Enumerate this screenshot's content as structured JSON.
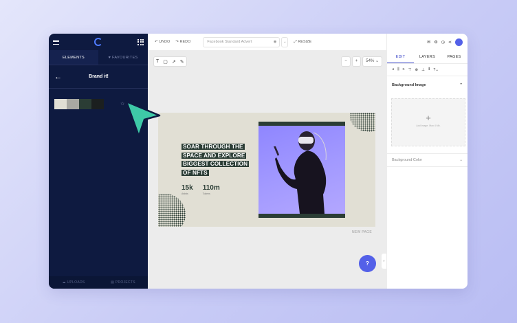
{
  "left_panel": {
    "tabs": [
      "ELEMENTS",
      "FAVOURITES"
    ],
    "title": "Brand it!",
    "swatches": [
      "#e1dfd4",
      "#a9a9a2",
      "#2b3d35",
      "#1b1f1f"
    ],
    "bottom": [
      "UPLOADS",
      "PROJECTS"
    ]
  },
  "topbar": {
    "undo": "UNDO",
    "redo": "REDO",
    "doc_name": "Facebook Standard Advert",
    "resize": "RESIZE"
  },
  "canvas": {
    "tools": [
      "T",
      "▢",
      "↗",
      "✎"
    ],
    "zoom_out": "−",
    "zoom_in": "+",
    "zoom": "54%",
    "new_page": "NEW PAGE",
    "help": "?"
  },
  "design": {
    "headline_lines": [
      "SOAR THROUGH THE",
      "SPACE AND EXPLORE",
      "BIGGEST COLLECTION",
      "OF NFTS"
    ],
    "stat1_value": "15k",
    "stat1_label": "Artists",
    "stat2_value": "110m",
    "stat2_label": "Tokens"
  },
  "right_panel": {
    "tabs": [
      "EDIT",
      "LAYERS",
      "PAGES"
    ],
    "bg_image_label": "Background Image",
    "upload_hint": "Add Image. Max 4 Mb.",
    "bg_color_label": "Background Color"
  },
  "colors": {
    "accent": "#5360e8",
    "dark_navy": "#0e1a40",
    "cursor": "#3ec9a7"
  }
}
